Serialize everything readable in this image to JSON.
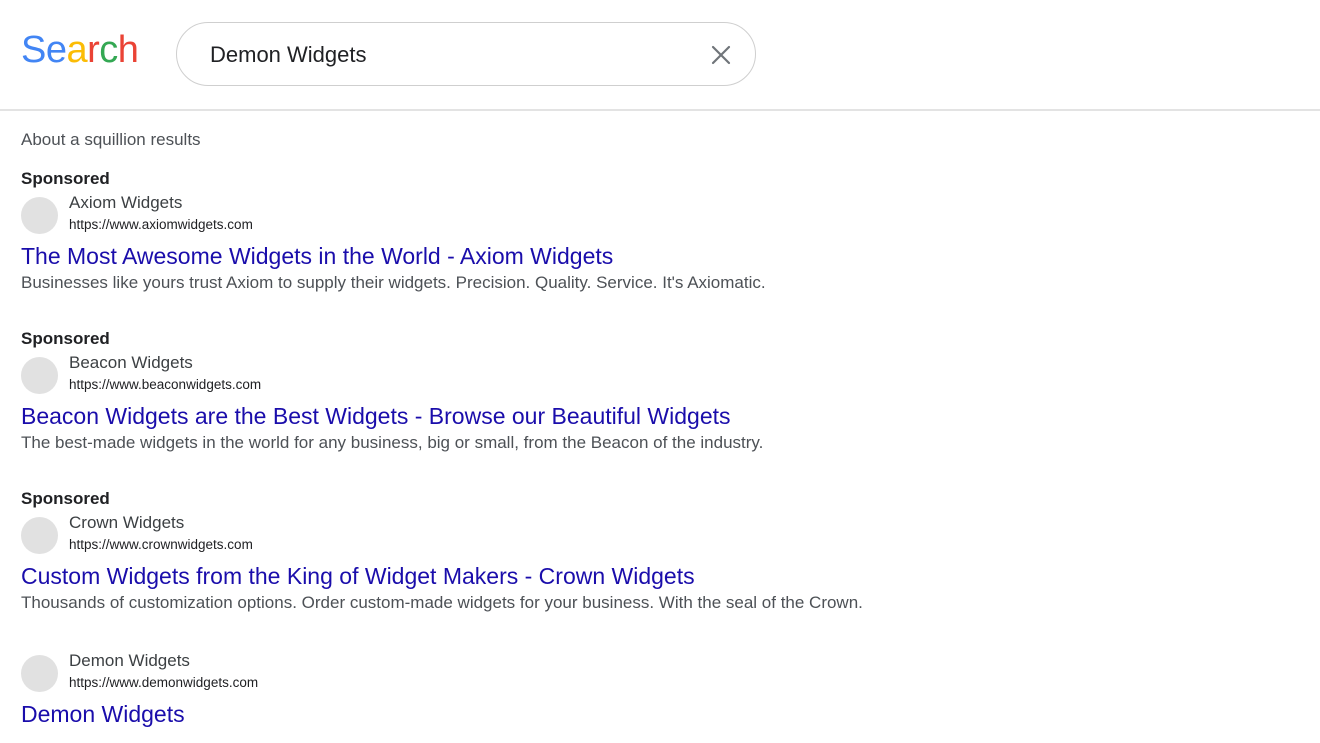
{
  "logo": {
    "letters": [
      {
        "char": "S",
        "color": "#4285f4"
      },
      {
        "char": "e",
        "color": "#4285f4"
      },
      {
        "char": "a",
        "color": "#fbbc05"
      },
      {
        "char": "r",
        "color": "#ea4335"
      },
      {
        "char": "c",
        "color": "#34a853"
      },
      {
        "char": "h",
        "color": "#ea4335"
      }
    ]
  },
  "search": {
    "value": "Demon Widgets",
    "clear_icon": "close-icon"
  },
  "stats": "About a squillion results",
  "results": [
    {
      "sponsored": true,
      "sponsored_label": "Sponsored",
      "site_name": "Axiom Widgets",
      "url": "https://www.axiomwidgets.com",
      "title": "The Most Awesome Widgets in the World - Axiom Widgets",
      "snippet": "Businesses like yours trust Axiom to supply their widgets. Precision. Quality. Service. It's Axiomatic."
    },
    {
      "sponsored": true,
      "sponsored_label": "Sponsored",
      "site_name": "Beacon Widgets",
      "url": "https://www.beaconwidgets.com",
      "title": "Beacon Widgets are the Best Widgets - Browse our Beautiful Widgets",
      "snippet": "The best-made widgets in the world for any business, big or small, from the Beacon of the industry."
    },
    {
      "sponsored": true,
      "sponsored_label": "Sponsored",
      "site_name": "Crown Widgets",
      "url": "https://www.crownwidgets.com",
      "title": "Custom Widgets from the King of Widget Makers - Crown Widgets",
      "snippet": "Thousands of customization options. Order custom-made widgets for your business. With the seal of the Crown."
    },
    {
      "sponsored": false,
      "site_name": "Demon Widgets",
      "url": "https://www.demonwidgets.com",
      "title": "Demon Widgets"
    }
  ],
  "colors": {
    "link": "#1a0dab",
    "snippet": "#4d5156",
    "favicon_placeholder": "#e1e1e1"
  }
}
